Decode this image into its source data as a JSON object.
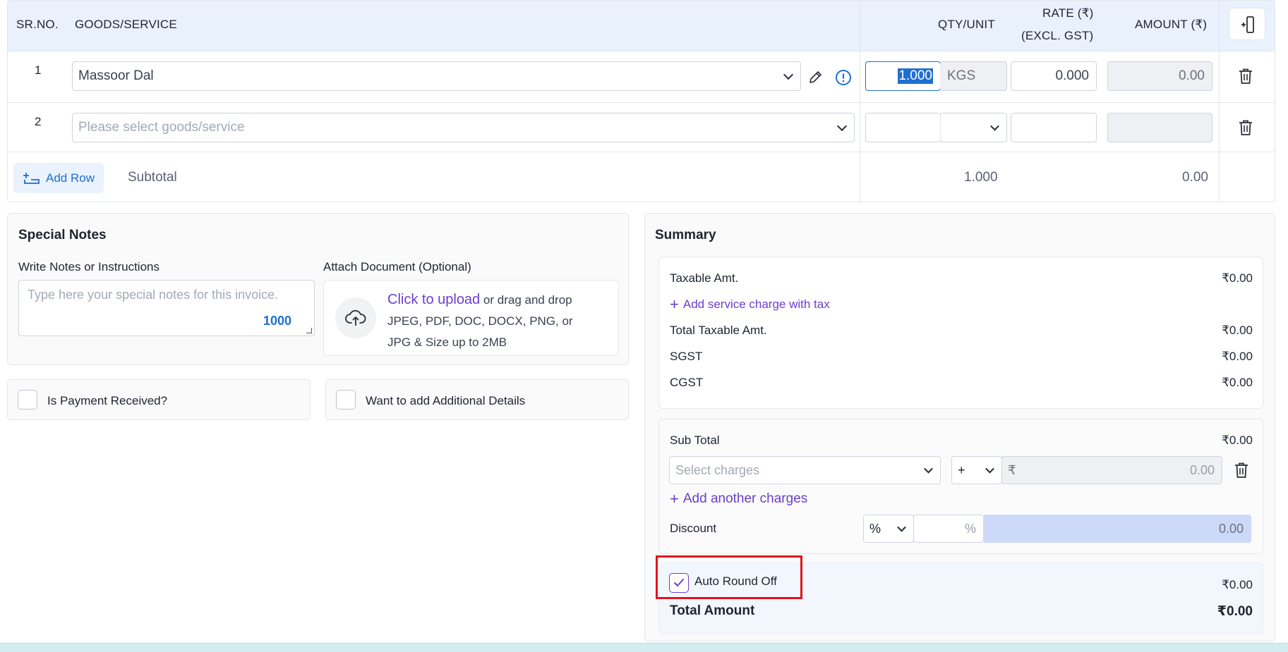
{
  "table": {
    "headers": {
      "srno": "SR.NO.",
      "goods": "GOODS/SERVICE",
      "qty": "QTY/UNIT",
      "rate_line1": "RATE (₹)",
      "rate_line2": "(EXCL. GST)",
      "amount": "AMOUNT (₹)"
    },
    "rows": [
      {
        "sr": "1",
        "goods": "Massoor Dal",
        "qty": "1.000",
        "unit": "KGS",
        "rate": "0.000",
        "amount": "0.00"
      },
      {
        "sr": "2",
        "goods_placeholder": "Please select goods/service",
        "qty": "",
        "unit": "",
        "rate": "",
        "amount": ""
      }
    ],
    "add_row_label": "Add Row",
    "subtotal_label": "Subtotal",
    "subtotal_qty": "1.000",
    "subtotal_amount": "0.00"
  },
  "notes": {
    "title": "Special Notes",
    "notes_label": "Write Notes or Instructions",
    "notes_placeholder": "Type here your special notes for this invoice.",
    "char_count": "1000",
    "attach_label": "Attach Document (Optional)",
    "upload_link": "Click to upload",
    "upload_text1": " or drag and drop",
    "upload_text2": "JPEG, PDF, DOC, DOCX, PNG, or",
    "upload_text3": "JPG & Size up to 2MB"
  },
  "checks": {
    "payment_label": "Is Payment Received?",
    "additional_label": "Want to add Additional Details"
  },
  "summary": {
    "title": "Summary",
    "taxable_label": "Taxable Amt.",
    "taxable_value": "₹0.00",
    "add_service_charge": "Add service charge with tax",
    "total_taxable_label": "Total Taxable Amt.",
    "total_taxable_value": "₹0.00",
    "sgst_label": "SGST",
    "sgst_value": "₹0.00",
    "cgst_label": "CGST",
    "cgst_value": "₹0.00",
    "subtotal_label": "Sub Total",
    "subtotal_value": "₹0.00",
    "charges_placeholder": "Select charges",
    "charge_sign": "+",
    "currency_symbol": "₹",
    "charge_amount": "0.00",
    "add_another_charges": "Add another charges",
    "discount_label": "Discount",
    "discount_type": "%",
    "discount_suffix": "%",
    "discount_amount": "0.00",
    "round_off_label": "Auto Round Off",
    "round_off_value": "₹0.00",
    "total_label": "Total Amount",
    "total_value": "₹0.00"
  },
  "colors": {
    "header_bg": "#e9f1fc",
    "link_purple": "#6b3fc9",
    "link_blue": "#1f6fd1",
    "highlight_red": "#e3141b"
  }
}
